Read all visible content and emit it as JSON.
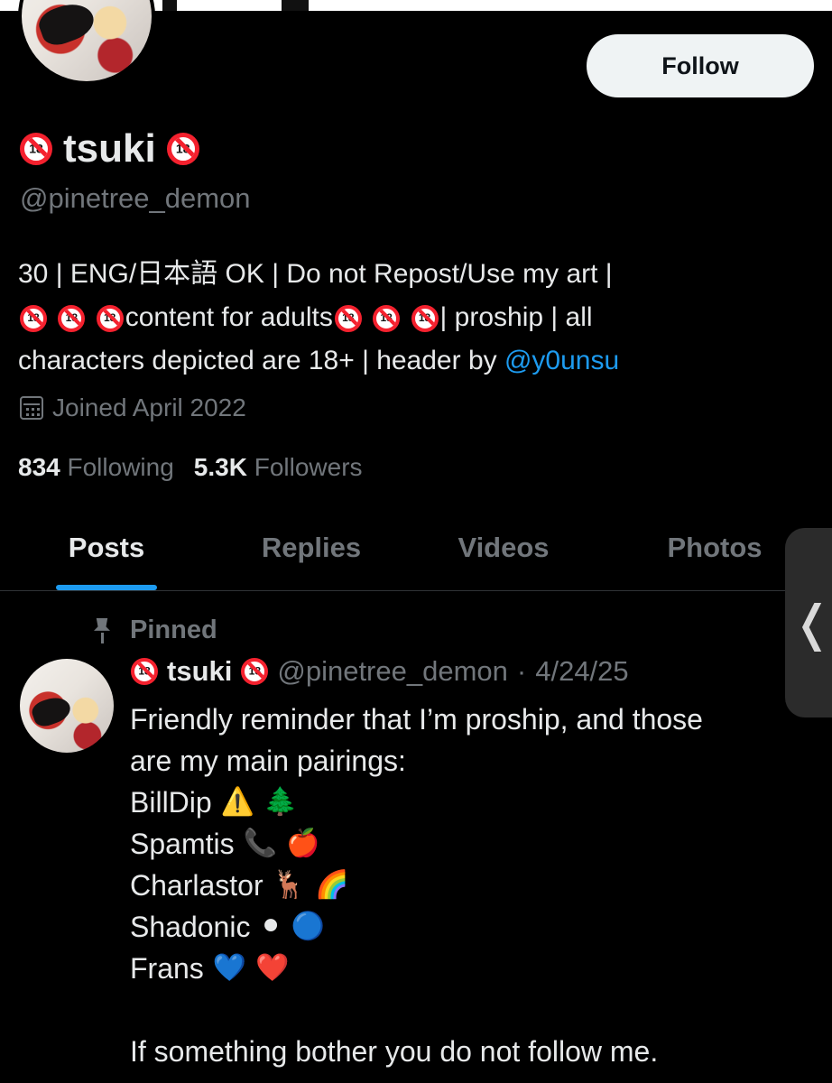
{
  "profile": {
    "display_name": "tsuki",
    "handle": "@pinetree_demon",
    "follow_label": "Follow",
    "bio": {
      "line1": "30 | ENG/日本語 OK | Do not Repost/Use my art |",
      "line2_a": "content for adults",
      "line2_b": "| proship | all",
      "line3_a": "characters depicted are 18+ | header by ",
      "line3_link": "@y0unsu"
    },
    "joined": "Joined April 2022",
    "following_count": "834",
    "following_label": "Following",
    "followers_count": "5.3K",
    "followers_label": "Followers"
  },
  "tabs": [
    {
      "label": "Posts",
      "active": true
    },
    {
      "label": "Replies",
      "active": false
    },
    {
      "label": "Videos",
      "active": false
    },
    {
      "label": "Photos",
      "active": false
    }
  ],
  "side_handle": {
    "glyph": "❬"
  },
  "pinned_post": {
    "pinned_label": "Pinned",
    "author_name": "tsuki",
    "author_handle": "@pinetree_demon",
    "separator": "·",
    "date": "4/24/25",
    "intro_1": "Friendly reminder that I’m proship, and those",
    "intro_2": "are my main pairings:",
    "pairings": [
      {
        "name": "BillDip",
        "emoji": [
          "⚠️",
          "🌲"
        ]
      },
      {
        "name": "Spamtis",
        "emoji": [
          "📞",
          "🍎"
        ]
      },
      {
        "name": "Charlastor",
        "emoji": [
          "🦌",
          "🌈"
        ]
      },
      {
        "name": "Shadonic",
        "emoji": [
          "⚫",
          "🔵"
        ]
      },
      {
        "name": "Frans",
        "emoji": [
          "💙",
          "❤️"
        ]
      }
    ],
    "closing": "If something bother you do not follow me."
  },
  "colors": {
    "background": "#000000",
    "text": "#e7e9ea",
    "muted": "#71767b",
    "accent": "#1d9bf0",
    "nsfw_badge": "#f4212e"
  },
  "icons": {
    "nsfw": "no-one-under-18-icon",
    "calendar": "calendar-icon",
    "pin": "pin-icon"
  }
}
